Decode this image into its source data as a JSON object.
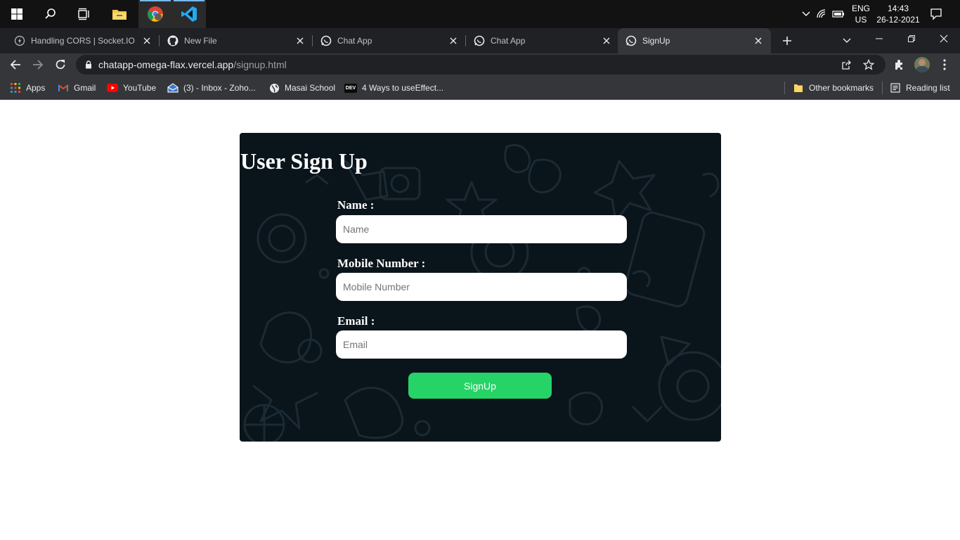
{
  "taskbar": {
    "apps": [
      "start-icon",
      "search-icon",
      "task-view-icon",
      "file-explorer-icon",
      "chrome-icon",
      "vscode-icon"
    ],
    "lang_top": "ENG",
    "lang_bottom": "US",
    "time": "14:43",
    "date": "26-12-2021"
  },
  "tabs": [
    {
      "title": "Handling CORS | Socket.IO",
      "icon": "socketio-icon"
    },
    {
      "title": "New File",
      "icon": "github-icon"
    },
    {
      "title": "Chat App",
      "icon": "chatapp-icon"
    },
    {
      "title": "Chat App",
      "icon": "chatapp-icon"
    },
    {
      "title": "SignUp",
      "icon": "chatapp-icon",
      "active": true
    }
  ],
  "address": {
    "domain": "chatapp-omega-flax.vercel.app",
    "path": "/signup.html"
  },
  "bookmarks": {
    "items": [
      "Apps",
      "Gmail",
      "YouTube",
      "(3) - Inbox - Zoho...",
      "Masai School",
      "4 Ways to useEffect..."
    ],
    "other": "Other bookmarks",
    "reading": "Reading list"
  },
  "form": {
    "title": "User Sign Up",
    "name_label": "Name :",
    "name_placeholder": "Name",
    "mobile_label": "Mobile Number :",
    "mobile_placeholder": "Mobile Number",
    "email_label": "Email :",
    "email_placeholder": "Email",
    "submit": "SignUp"
  },
  "colors": {
    "card_bg": "#0a141b",
    "button": "#25d366"
  }
}
